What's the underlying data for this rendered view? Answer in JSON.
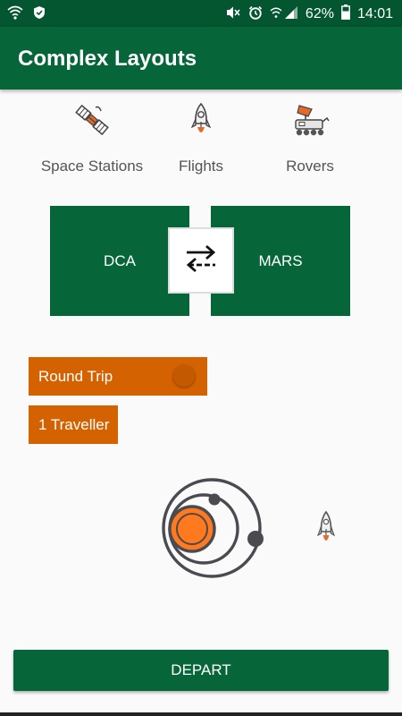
{
  "status_bar": {
    "battery": "62%",
    "time": "14:01",
    "icons": [
      "wifi-icon",
      "shield-icon",
      "mute-icon",
      "alarm-icon",
      "signal-icon",
      "battery-icon"
    ]
  },
  "app_bar": {
    "title": "Complex Layouts"
  },
  "categories": [
    {
      "label": "Space Stations",
      "icon": "satellite-icon"
    },
    {
      "label": "Flights",
      "icon": "rocket-icon"
    },
    {
      "label": "Rovers",
      "icon": "rover-icon"
    }
  ],
  "route": {
    "from": "DCA",
    "to": "MARS",
    "swap_icon": "swap-arrows-icon"
  },
  "trip": {
    "label": "Round Trip",
    "toggle_on": false
  },
  "travellers": {
    "label": "1 Traveller"
  },
  "art": {
    "icons": [
      "solar-system-icon",
      "rocket-icon"
    ]
  },
  "depart_button": {
    "label": "DEPART"
  },
  "colors": {
    "primary": "#07653a",
    "status": "#03562f",
    "accent": "#d56200",
    "background": "#fafafa"
  }
}
